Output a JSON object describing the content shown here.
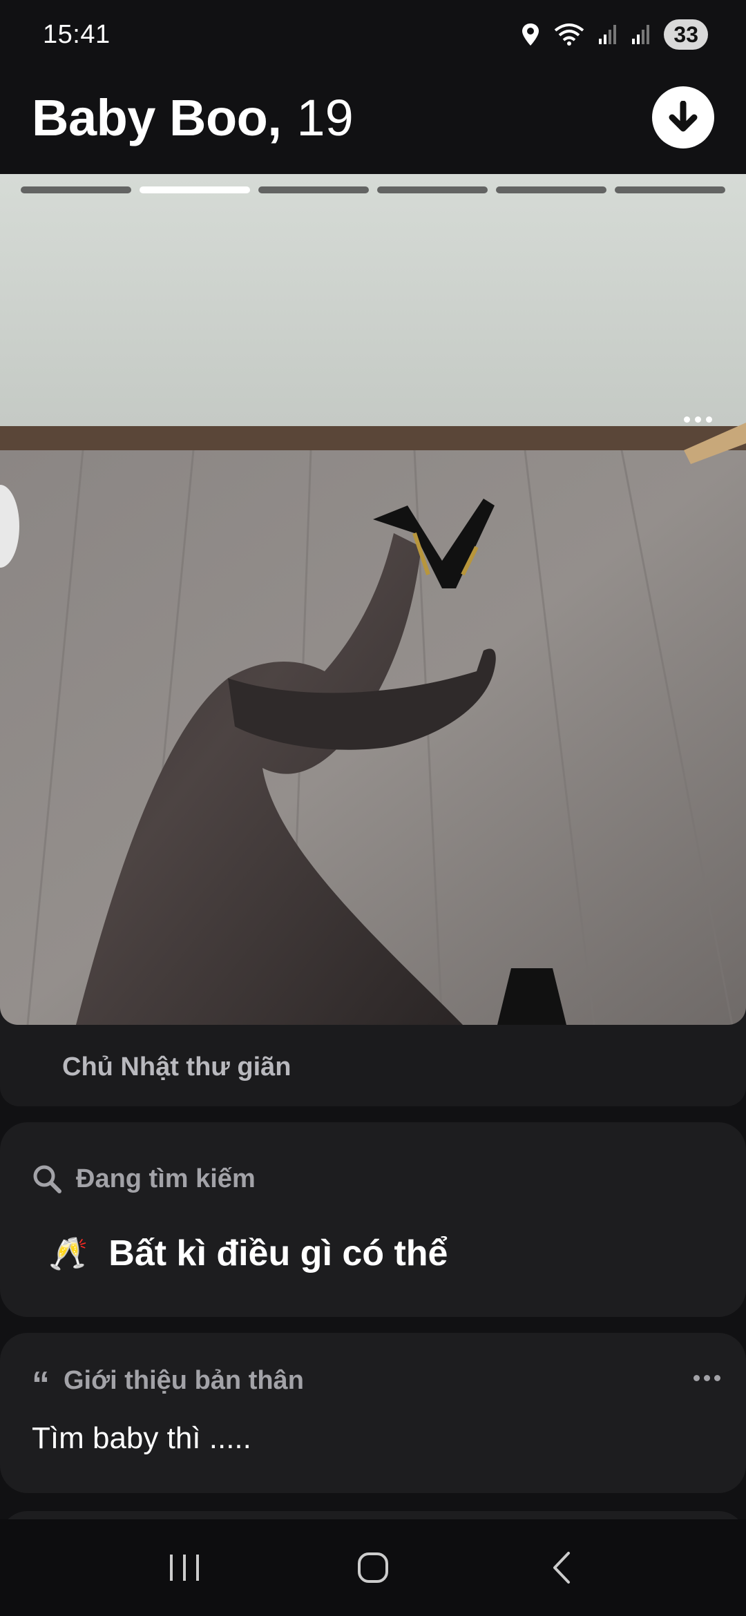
{
  "status_bar": {
    "time": "15:41",
    "battery": "33",
    "icons": [
      "location-icon",
      "wifi-icon",
      "signal-icon",
      "signal-icon",
      "battery-icon"
    ]
  },
  "header": {
    "name": "Baby Boo,",
    "age": "19",
    "download_icon": "arrow-down-circle-icon"
  },
  "photo": {
    "total_photos": 6,
    "active_index": 1,
    "caption": "Chủ Nhật thư giãn"
  },
  "looking_for": {
    "label": "Đang tìm kiếm",
    "emoji": "🥂",
    "value": "Bất kì điều gì có thể"
  },
  "bio": {
    "label": "Giới thiệu bản thân",
    "quote_icon": "“",
    "text": "Tìm baby thì ....."
  },
  "colors": {
    "background": "#111113",
    "card": "#1d1d1f",
    "muted_text": "#a3a3a8",
    "active_progress": "#ffffff"
  }
}
